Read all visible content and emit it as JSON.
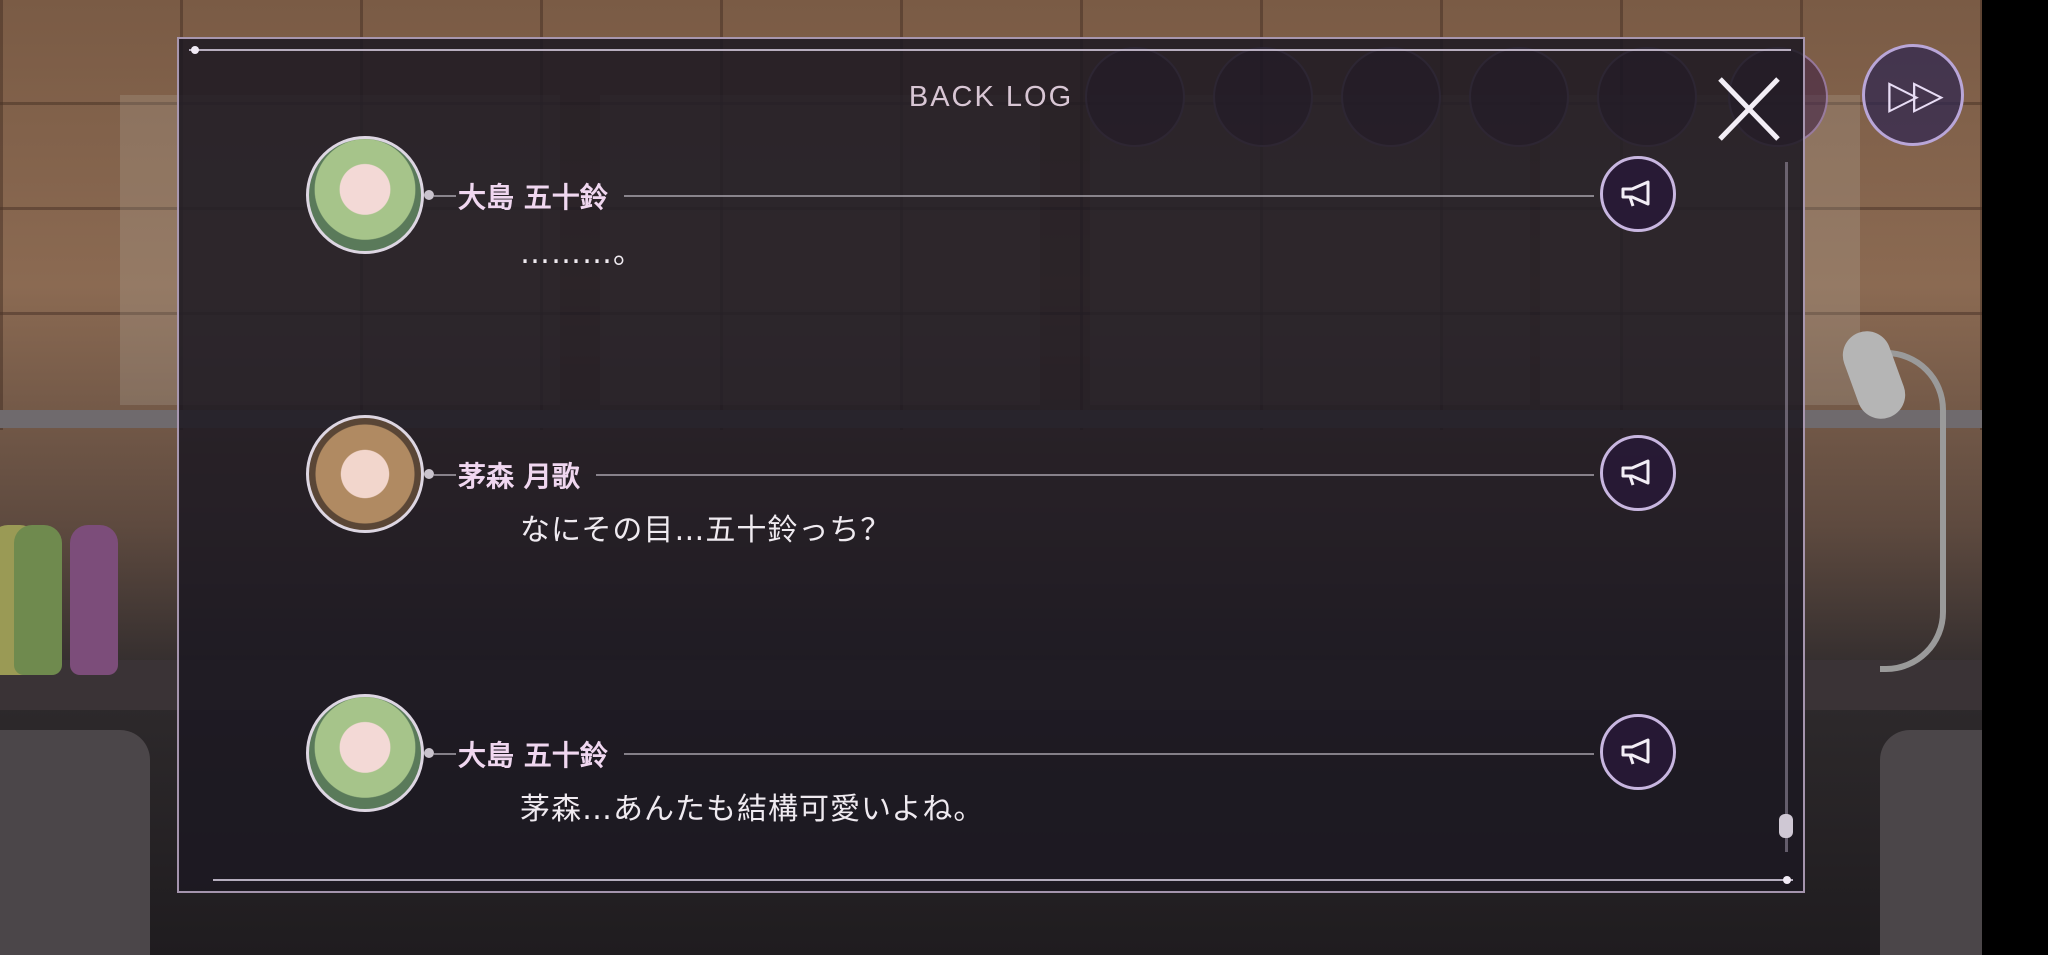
{
  "window": {
    "title": "BACK LOG"
  },
  "controls": {
    "close_icon": "close-x-icon",
    "fast_forward_icon": "fast-forward-icon",
    "fast_forward_glyph": "▷▷"
  },
  "colors": {
    "name_text": "#f0d7f0",
    "accent_ring": "#c8b6e0",
    "panel_bg": "#1c1822"
  },
  "log": {
    "entries": [
      {
        "speaker": "大島 五十鈴",
        "text": "………。",
        "avatar": "isuzu-oshima-avatar",
        "voice_icon": "megaphone-icon"
      },
      {
        "speaker": "茅森 月歌",
        "text": "なにその目…五十鈴っち？",
        "avatar": "ruka-kayamori-avatar",
        "voice_icon": "megaphone-icon"
      },
      {
        "speaker": "大島 五十鈴",
        "text": "茅森…あんたも結構可愛いよね。",
        "avatar": "isuzu-oshima-avatar",
        "voice_icon": "megaphone-icon"
      }
    ]
  }
}
